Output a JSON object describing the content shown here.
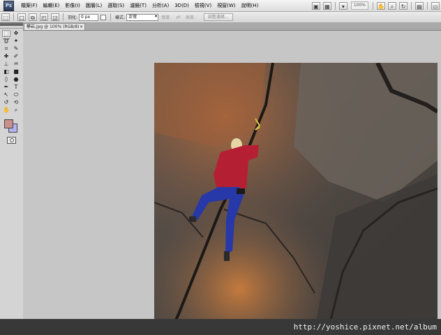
{
  "app": {
    "logo": "Ps"
  },
  "menu": [
    {
      "id": "file",
      "label": "檔案(F)"
    },
    {
      "id": "edit",
      "label": "編輯(E)"
    },
    {
      "id": "image",
      "label": "影像(I)"
    },
    {
      "id": "layer",
      "label": "圖層(L)"
    },
    {
      "id": "select",
      "label": "選取(S)"
    },
    {
      "id": "filter",
      "label": "濾鏡(T)"
    },
    {
      "id": "analysis",
      "label": "分析(A)"
    },
    {
      "id": "3d",
      "label": "3D(D)"
    },
    {
      "id": "view",
      "label": "檢視(V)"
    },
    {
      "id": "window",
      "label": "視窗(W)"
    },
    {
      "id": "help",
      "label": "說明(H)"
    }
  ],
  "menubar_right": {
    "zoom_level": "100%"
  },
  "options": {
    "feather_label": "羽化:",
    "feather_value": "0 px",
    "style_label": "樣式:",
    "style_value": "正常",
    "width_label": "寬度:",
    "height_label": "高度:",
    "refine_button": "調整邊緣..."
  },
  "document": {
    "tab_title": "攀岩.jpg @ 100% (RGB/8)",
    "close_glyph": "×"
  },
  "colors": {
    "foreground": "#c9908c",
    "background": "#b5b2f2"
  },
  "watermark": "http://yoshice.pixnet.net/album"
}
